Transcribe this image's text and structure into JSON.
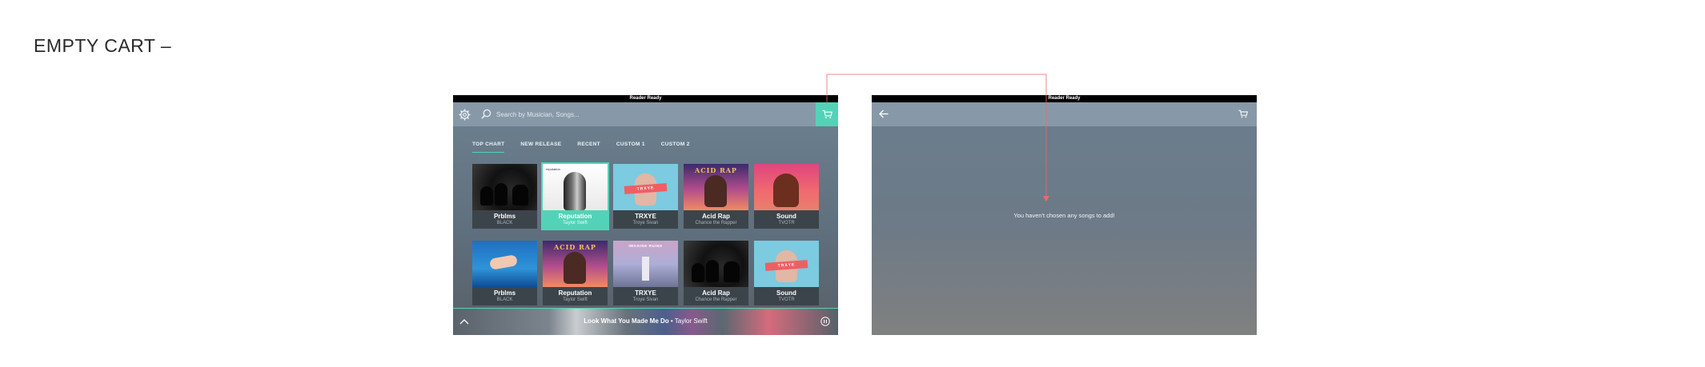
{
  "page": {
    "title": "EMPTY CART –"
  },
  "screen_a": {
    "status": "Reader Ready",
    "search": {
      "placeholder": "Search by Musician, Songs..."
    },
    "tabs": [
      {
        "label": "TOP CHART"
      },
      {
        "label": "NEW RELEASE"
      },
      {
        "label": "RECENT"
      },
      {
        "label": "CUSTOM 1"
      },
      {
        "label": "CUSTOM 2"
      }
    ],
    "rows": [
      [
        {
          "title": "Prblms",
          "artist": "BLACK"
        },
        {
          "title": "Reputation",
          "artist": "Taylor Swift"
        },
        {
          "title": "TRXYE",
          "artist": "Troye Sivan"
        },
        {
          "title": "Acid Rap",
          "artist": "Chance the Rapper"
        },
        {
          "title": "Sound",
          "artist": "TVOTR"
        }
      ],
      [
        {
          "title": "Prblms",
          "artist": "BLACK"
        },
        {
          "title": "Reputation",
          "artist": "Taylor Swift"
        },
        {
          "title": "TRXYE",
          "artist": "Troye Sivan"
        },
        {
          "title": "Acid Rap",
          "artist": "Chance the Rapper"
        },
        {
          "title": "Sound",
          "artist": "TVOTR"
        }
      ]
    ],
    "art_text": {
      "reputation": "reputation",
      "troye_band": "TRXYE",
      "acid": "ACID RAP",
      "ruins": "IMAGINE RUINS"
    },
    "now_playing": {
      "song": "Look What You Made Me Do",
      "separator": " • ",
      "artist": "Taylor Swift"
    }
  },
  "screen_b": {
    "status": "Reader Ready",
    "empty_message": "You haven't chosen any songs to add!"
  },
  "colors": {
    "accent": "#52d3b7",
    "annotation": "#e96a6a"
  }
}
